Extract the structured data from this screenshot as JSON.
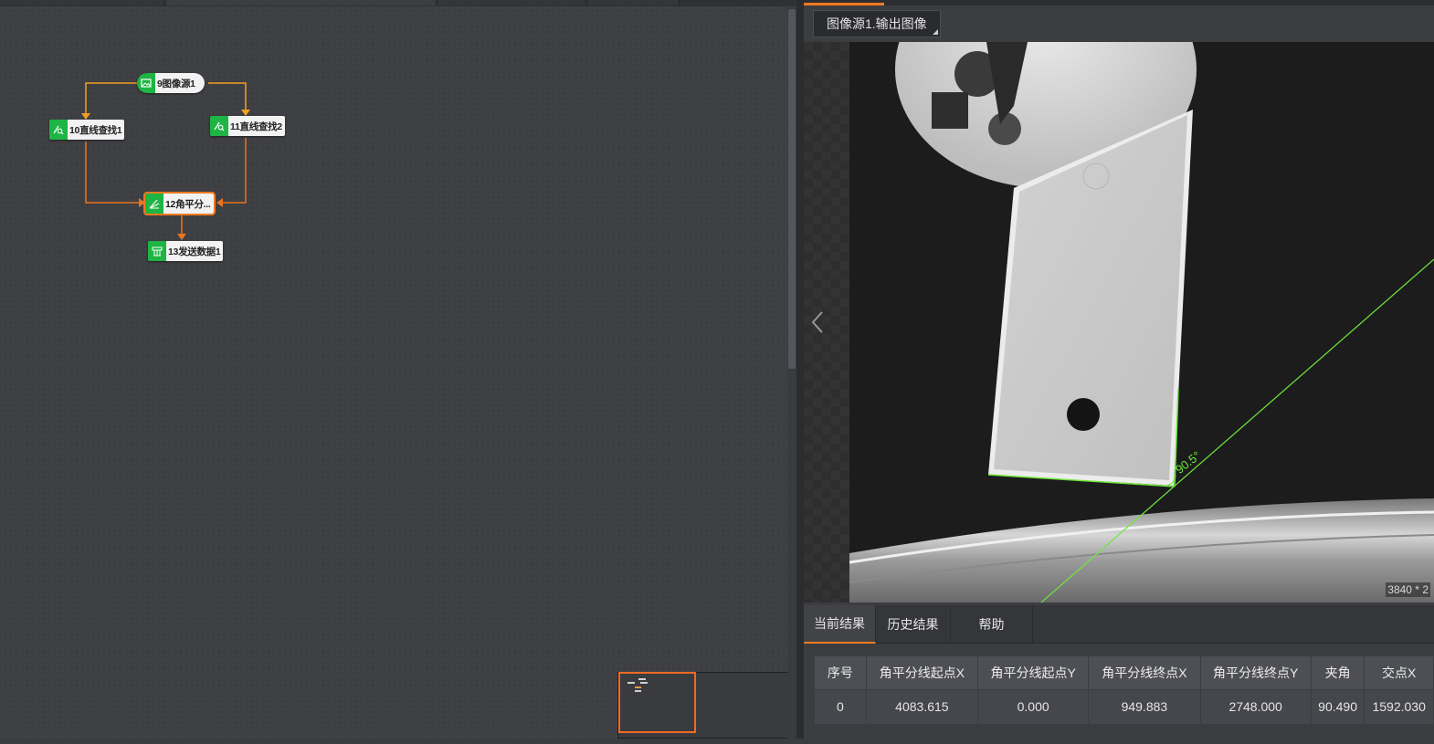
{
  "flow": {
    "nodes": [
      {
        "id": "9",
        "label": "9图像源1",
        "icon": "image-icon"
      },
      {
        "id": "10",
        "label": "10直线查找1",
        "icon": "line-find-icon"
      },
      {
        "id": "11",
        "label": "11直线查找2",
        "icon": "line-find-icon"
      },
      {
        "id": "12",
        "label": "12角平分...",
        "icon": "angle-bisector-icon"
      },
      {
        "id": "13",
        "label": "13发送数据1",
        "icon": "send-data-icon"
      }
    ]
  },
  "viewer": {
    "source_tab": "图像源1.输出图像",
    "angle_label": "90.5°",
    "resolution": "3840 * 2"
  },
  "results": {
    "tabs": [
      "当前结果",
      "历史结果",
      "帮助"
    ],
    "columns": [
      "序号",
      "角平分线起点X",
      "角平分线起点Y",
      "角平分线终点X",
      "角平分线终点Y",
      "夹角",
      "交点X"
    ],
    "rows": [
      [
        "0",
        "4083.615",
        "0.000",
        "949.883",
        "2748.000",
        "90.490",
        "1592.030"
      ]
    ]
  },
  "colors": {
    "accent": "#f07a22",
    "node_icon": "#1eb544",
    "overlay_line": "#6ee83a"
  }
}
